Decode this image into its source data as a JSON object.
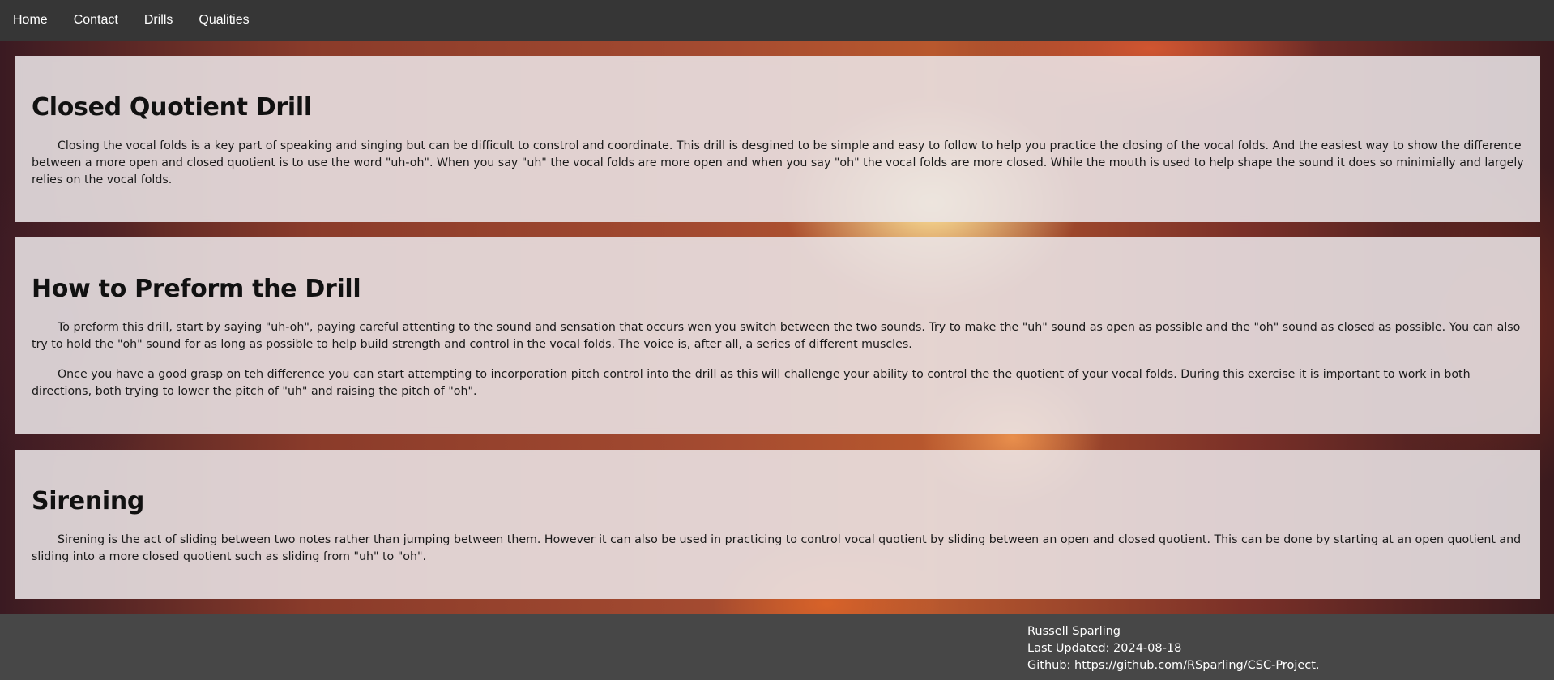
{
  "nav": {
    "items": [
      {
        "label": "Home"
      },
      {
        "label": "Contact"
      },
      {
        "label": "Drills"
      },
      {
        "label": "Qualities"
      }
    ]
  },
  "sections": [
    {
      "title": "Closed Quotient Drill",
      "paragraphs": [
        "Closing the vocal folds is a key part of speaking and singing but can be difficult to constrol and coordinate. This drill is desgined to be simple and easy to follow to help you practice the closing of the vocal folds. And the easiest way to show the difference between a more open and closed quotient is to use the word \"uh-oh\". When you say \"uh\" the vocal folds are more open and when you say \"oh\" the vocal folds are more closed. While the mouth is used to help shape the sound it does so minimially and largely relies on the vocal folds."
      ]
    },
    {
      "title": "How to Preform the Drill",
      "paragraphs": [
        "To preform this drill, start by saying \"uh-oh\", paying careful attenting to the sound and sensation that occurs wen you switch between the two sounds. Try to make the \"uh\" sound as open as possible and the \"oh\" sound as closed as possible. You can also try to hold the \"oh\" sound for as long as possible to help build strength and control in the vocal folds. The voice is, after all, a series of different muscles.",
        "Once you have a good grasp on teh difference you can start attempting to incorporation pitch control into the drill as this will challenge your ability to control the the quotient of your vocal folds. During this exercise it is important to work in both directions, both trying to lower the pitch of \"uh\" and raising the pitch of \"oh\"."
      ]
    },
    {
      "title": "Sirening",
      "paragraphs": [
        "Sirening is the act of sliding between two notes rather than jumping between them. However it can also be used in practicing to control vocal quotient by sliding between an open and closed quotient. This can be done by starting at an open quotient and sliding into a more closed quotient such as sliding from \"uh\" to \"oh\"."
      ]
    }
  ],
  "footer": {
    "author": "Russell Sparling",
    "updated": "Last Updated: 2024-08-18",
    "github": "Github: https://github.com/RSparling/CSC-Project."
  },
  "colors": {
    "navbar": "#363636",
    "footer": "#474747",
    "panel": "#ebe5e7"
  }
}
